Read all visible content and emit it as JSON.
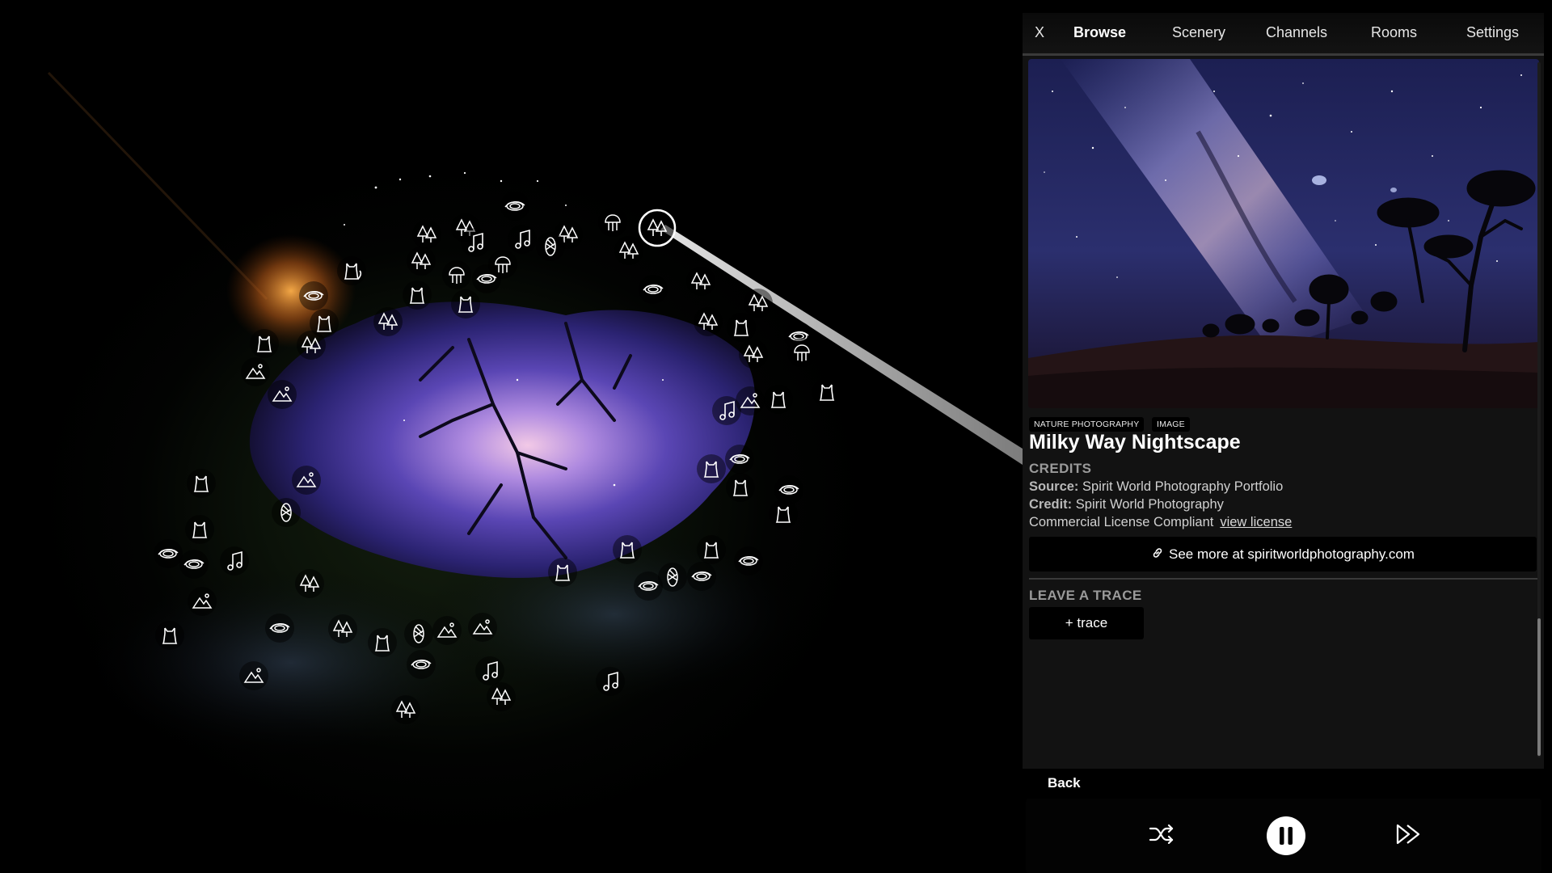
{
  "tabs": {
    "close_label": "X",
    "items": [
      "Browse",
      "Scenery",
      "Channels",
      "Rooms",
      "Settings"
    ],
    "active": "Browse"
  },
  "item": {
    "badges": [
      "NATURE PHOTOGRAPHY",
      "IMAGE"
    ],
    "title": "Milky Way Nightscape",
    "credits_heading": "CREDITS",
    "source_label": "Source:",
    "source_value": "Spirit World Photography Portfolio",
    "credit_label": "Credit:",
    "credit_value": "Spirit World Photography",
    "license_text": "Commercial License Compliant",
    "license_link": "view license",
    "see_more": "See more at spiritworldphotography.com"
  },
  "trace": {
    "heading": "LEAVE A TRACE",
    "button": "+ trace"
  },
  "navigation": {
    "back": "Back"
  },
  "player": {
    "controls": [
      "shuffle-icon",
      "pause-icon",
      "skip-forward-icon"
    ]
  },
  "scene": {
    "node_icons": [
      "cat",
      "tree",
      "galaxy",
      "music",
      "mountain",
      "jellyfish",
      "pinecone"
    ]
  },
  "colors": {
    "panel_bg": "#121212",
    "tab_bg": "#0a0a0a",
    "accent_text": "#9a9a9a"
  }
}
